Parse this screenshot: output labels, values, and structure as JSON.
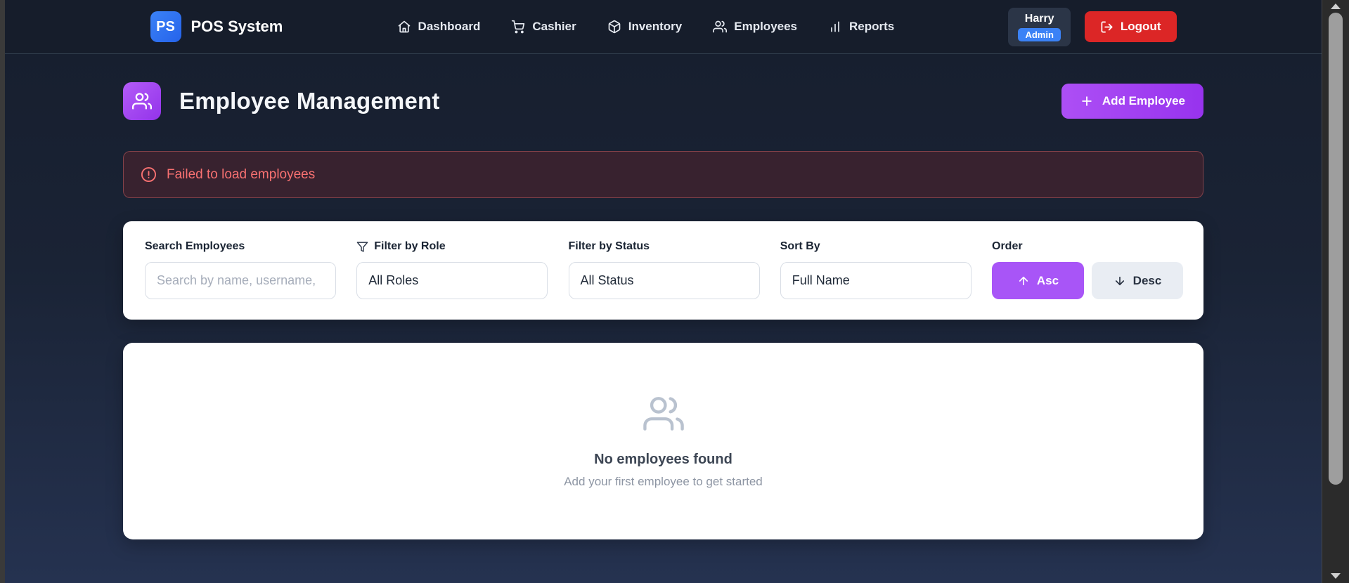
{
  "brand": {
    "logo": "PS",
    "title": "POS System"
  },
  "nav": {
    "items": [
      {
        "label": "Dashboard",
        "icon": "home-icon"
      },
      {
        "label": "Cashier",
        "icon": "cart-icon"
      },
      {
        "label": "Inventory",
        "icon": "box-icon"
      },
      {
        "label": "Employees",
        "icon": "users-icon"
      },
      {
        "label": "Reports",
        "icon": "bar-chart-icon"
      }
    ]
  },
  "user": {
    "name": "Harry",
    "role_badge": "Admin"
  },
  "logout_label": "Logout",
  "page": {
    "title": "Employee Management",
    "add_button": "Add Employee"
  },
  "alert": {
    "message": "Failed to load employees",
    "icon": "alert-circle-icon"
  },
  "filters": {
    "search": {
      "label": "Search Employees",
      "placeholder": "Search by name, username,"
    },
    "role": {
      "label": "Filter by Role",
      "value": "All Roles",
      "icon": "funnel-icon"
    },
    "status": {
      "label": "Filter by Status",
      "value": "All Status"
    },
    "sort": {
      "label": "Sort By",
      "value": "Full Name"
    },
    "order": {
      "label": "Order",
      "asc": "Asc",
      "desc": "Desc"
    }
  },
  "empty_state": {
    "title": "No employees found",
    "subtitle": "Add your first employee to get started",
    "icon": "users-icon"
  },
  "colors": {
    "accent_purple": "#a855f7",
    "logout_red": "#dc2626",
    "badge_blue": "#3b82f6",
    "logo_blue": "#2563eb",
    "error_text": "#f87171",
    "navbar_bg": "#161d2b",
    "content_bg_top": "#171f2f",
    "content_bg_bottom": "#253250",
    "card_bg": "#ffffff"
  }
}
